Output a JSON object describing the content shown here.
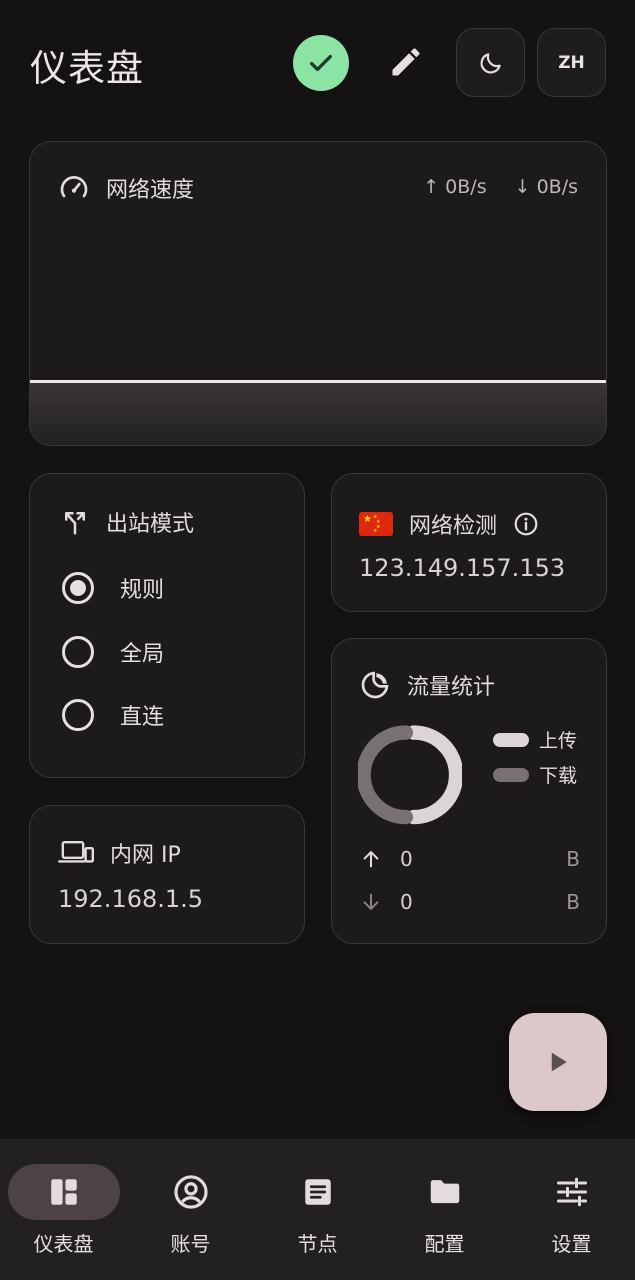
{
  "header": {
    "title": "仪表盘",
    "lang_label": "ZH"
  },
  "speed": {
    "title": "网络速度",
    "upload": "↑ 0B/s",
    "download": "↓ 0B/s"
  },
  "outbound": {
    "title": "出站模式",
    "options": [
      {
        "label": "规则",
        "selected": true
      },
      {
        "label": "全局",
        "selected": false
      },
      {
        "label": "直连",
        "selected": false
      }
    ]
  },
  "network_check": {
    "title": "网络检测",
    "ip": "123.149.157.153"
  },
  "lan": {
    "title": "内网 IP",
    "ip": "192.168.1.5"
  },
  "traffic": {
    "title": "流量统计",
    "legend_upload": "上传",
    "legend_download": "下载",
    "upload_value": "0",
    "upload_unit": "B",
    "download_value": "0",
    "download_unit": "B"
  },
  "nav": {
    "items": [
      {
        "label": "仪表盘",
        "icon": "dashboard-icon",
        "active": true
      },
      {
        "label": "账号",
        "icon": "account-icon",
        "active": false
      },
      {
        "label": "节点",
        "icon": "nodes-icon",
        "active": false
      },
      {
        "label": "配置",
        "icon": "folder-icon",
        "active": false
      },
      {
        "label": "设置",
        "icon": "settings-icon",
        "active": false
      }
    ]
  },
  "colors": {
    "status_ok": "#8be3a4",
    "upload_series": "#dcd4d5",
    "download_series": "#787072",
    "fab": "#dcc8c9"
  }
}
